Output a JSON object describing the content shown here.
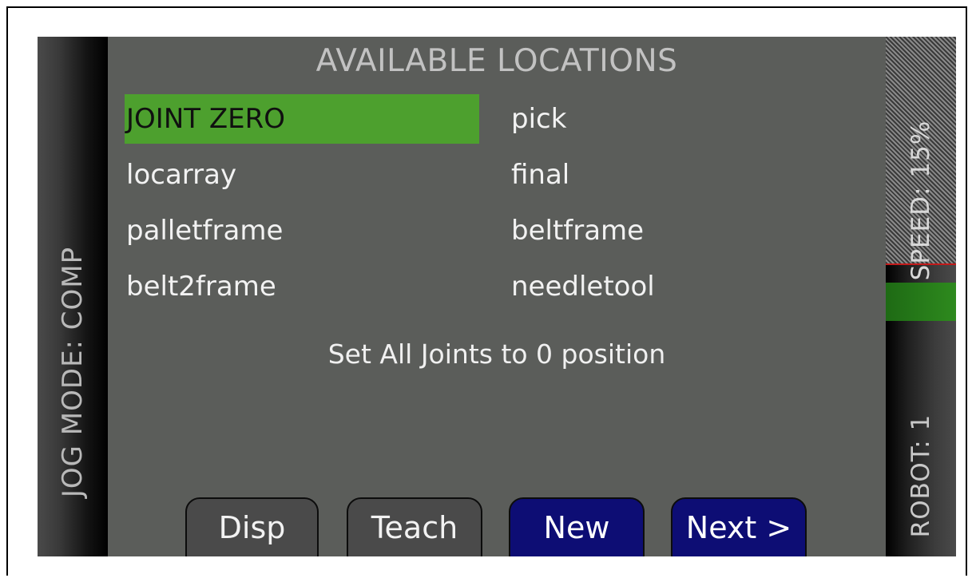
{
  "left_bar": {
    "jog_mode": "JOG MODE: COMP"
  },
  "right_bar": {
    "speed": "SPEED: 15%",
    "speed_percent": 15,
    "robot": "ROBOT: 1"
  },
  "title": "AVAILABLE LOCATIONS",
  "locations": [
    {
      "label": "JOINT ZERO",
      "selected": true
    },
    {
      "label": "pick"
    },
    {
      "label": "locarray"
    },
    {
      "label": "final"
    },
    {
      "label": "palletframe"
    },
    {
      "label": "beltframe"
    },
    {
      "label": "belt2frame"
    },
    {
      "label": "needletool"
    }
  ],
  "description": "Set All Joints to 0 position",
  "buttons": {
    "disp": "Disp",
    "teach": "Teach",
    "new": "New",
    "next": "Next >"
  },
  "colors": {
    "selected": "#4da02e",
    "screen_bg": "#5b5d5a",
    "blue_button": "#0d0d74",
    "speed_fill": "#2e8a1e"
  }
}
